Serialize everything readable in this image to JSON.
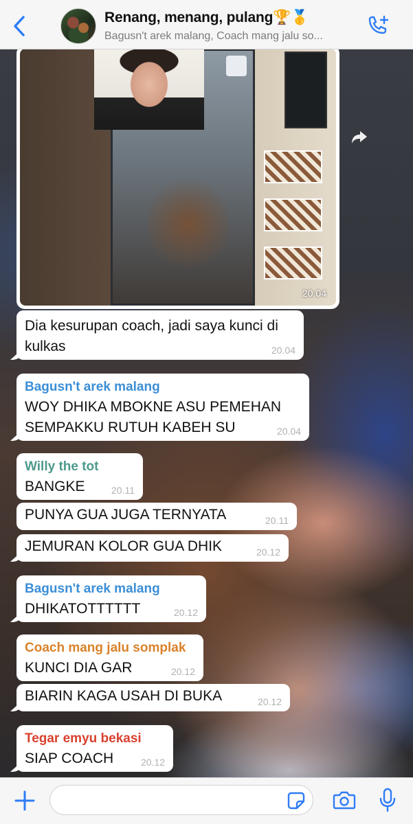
{
  "header": {
    "title": "Renang, menang, pulang🏆🥇",
    "subtitle": "Bagusn't arek malang, Coach mang jalu so...",
    "icons": {
      "back": "chevron-left-icon",
      "call": "add-call-icon"
    }
  },
  "image_message": {
    "time": "20.04",
    "forward_icon": "forward-icon"
  },
  "messages": [
    {
      "sender": "",
      "sender_color": "",
      "text": "Dia kesurupan coach, jadi saya kunci di kulkas",
      "time": "20.04"
    },
    {
      "sender": "Bagusn't arek malang",
      "sender_color": "#3b8ed6",
      "text": "WOY DHIKA MBOKNE ASU PEMEHAN SEMPAKKU RUTUH KABEH SU",
      "time": "20.04"
    },
    {
      "sender": "Willy the tot",
      "sender_color": "#4e9a8c",
      "text": "BANGKE",
      "time": "20.11"
    },
    {
      "sender": "",
      "sender_color": "",
      "text": "PUNYA GUA JUGA TERNYATA",
      "time": "20.11"
    },
    {
      "sender": "",
      "sender_color": "",
      "text": "JEMURAN KOLOR GUA DHIK",
      "time": "20.12"
    },
    {
      "sender": "Bagusn't arek malang",
      "sender_color": "#3b8ed6",
      "text": "DHIKATOTTTTTT",
      "time": "20.12"
    },
    {
      "sender": "Coach mang jalu somplak",
      "sender_color": "#d9822b",
      "text": "KUNCI DIA GAR",
      "time": "20.12"
    },
    {
      "sender": "",
      "sender_color": "",
      "text": "BIARIN KAGA USAH DI BUKA",
      "time": "20.12"
    },
    {
      "sender": "Tegar emyu bekasi",
      "sender_color": "#d8412f",
      "text": "SIAP COACH",
      "time": "20.12"
    }
  ],
  "input_bar": {
    "message_value": "",
    "icons": {
      "add": "plus-icon",
      "sticker": "sticker-icon",
      "camera": "camera-icon",
      "mic": "microphone-icon"
    }
  },
  "colors": {
    "accent": "#2f7cf6",
    "bubble": "#ffffff",
    "timestamp": "#b1b1b4"
  }
}
